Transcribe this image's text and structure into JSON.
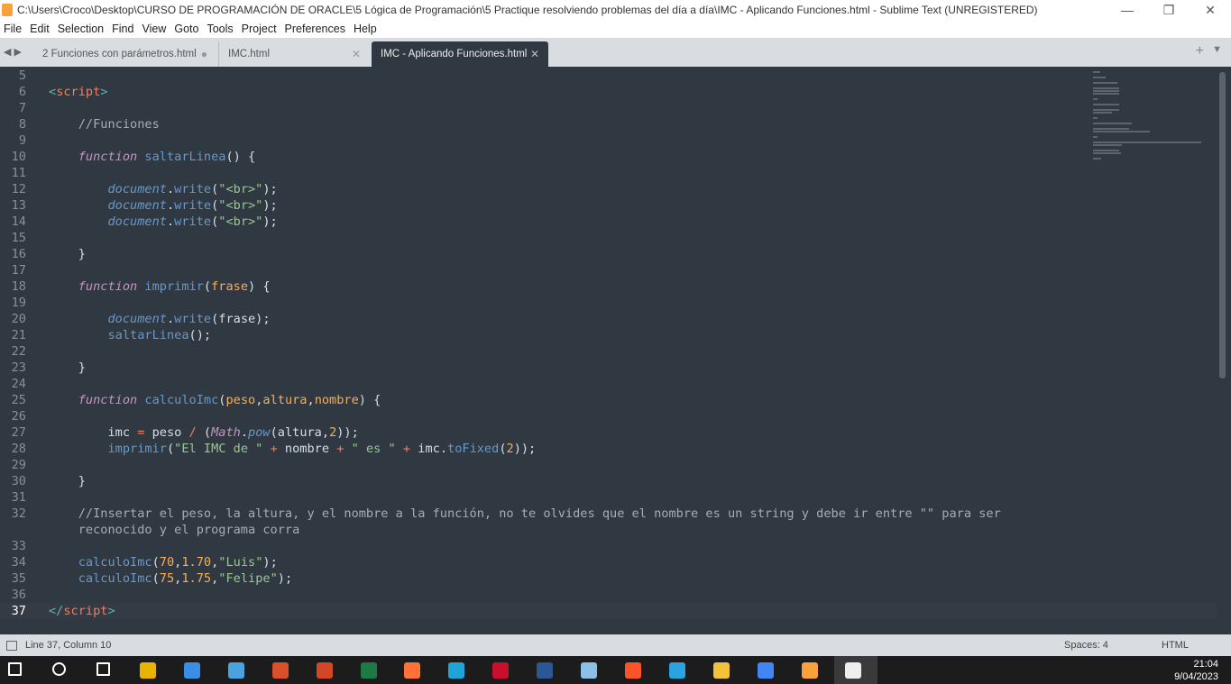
{
  "window": {
    "title": "C:\\Users\\Croco\\Desktop\\CURSO DE PROGRAMACIÓN DE ORACLE\\5 Lógica de Programación\\5 Practique resolviendo problemas del día a día\\IMC - Aplicando Funciones.html - Sublime Text (UNREGISTERED)",
    "minimize": "—",
    "maximize": "❐",
    "close": "✕"
  },
  "menu": [
    "File",
    "Edit",
    "Selection",
    "Find",
    "View",
    "Goto",
    "Tools",
    "Project",
    "Preferences",
    "Help"
  ],
  "tabs": [
    {
      "label": "2 Funciones con parámetros.html",
      "mark": "●"
    },
    {
      "label": "IMC.html",
      "mark": "✕"
    },
    {
      "label": "IMC - Aplicando Funciones.html",
      "mark": "✕",
      "active": true
    }
  ],
  "tabbar": {
    "nav": "◀ ▶",
    "plus": "+",
    "menu": "▼"
  },
  "colors": {
    "background": "#303841",
    "keyword": "#c594c5",
    "function": "#6699cc",
    "string": "#99c794",
    "operator": "#f97b58",
    "number": "#f9ae58"
  },
  "code": [
    {
      "n": "5",
      "t": []
    },
    {
      "n": "6",
      "t": [
        [
          "pu",
          "<"
        ],
        [
          "tg",
          "script"
        ],
        [
          "pu",
          ">"
        ]
      ]
    },
    {
      "n": "7",
      "t": []
    },
    {
      "n": "8",
      "t": [
        [
          "",
          "    "
        ],
        [
          "cm",
          "//Funciones"
        ]
      ]
    },
    {
      "n": "9",
      "t": []
    },
    {
      "n": "10",
      "t": [
        [
          "",
          "    "
        ],
        [
          "kw",
          "function"
        ],
        [
          "",
          " "
        ],
        [
          "fn",
          "saltarLinea"
        ],
        [
          "",
          "() {"
        ]
      ]
    },
    {
      "n": "11",
      "t": []
    },
    {
      "n": "12",
      "t": [
        [
          "",
          "        "
        ],
        [
          "fni",
          "document"
        ],
        [
          "",
          ".",
          ""
        ],
        [
          "fn",
          "write"
        ],
        [
          "",
          "("
        ],
        [
          "st",
          "\"<br>\""
        ],
        [
          "",
          ");"
        ]
      ]
    },
    {
      "n": "13",
      "t": [
        [
          "",
          "        "
        ],
        [
          "fni",
          "document"
        ],
        [
          "",
          "."
        ],
        [
          "fn",
          "write"
        ],
        [
          "",
          "("
        ],
        [
          "st",
          "\"<br>\""
        ],
        [
          "",
          ");"
        ]
      ]
    },
    {
      "n": "14",
      "t": [
        [
          "",
          "        "
        ],
        [
          "fni",
          "document"
        ],
        [
          "",
          "."
        ],
        [
          "fn",
          "write"
        ],
        [
          "",
          "("
        ],
        [
          "st",
          "\"<br>\""
        ],
        [
          "",
          ");"
        ]
      ]
    },
    {
      "n": "15",
      "t": []
    },
    {
      "n": "16",
      "t": [
        [
          "",
          "    }"
        ]
      ]
    },
    {
      "n": "17",
      "t": []
    },
    {
      "n": "18",
      "t": [
        [
          "",
          "    "
        ],
        [
          "kw",
          "function"
        ],
        [
          "",
          " "
        ],
        [
          "fn",
          "imprimir"
        ],
        [
          "",
          "("
        ],
        [
          "pm",
          "frase"
        ],
        [
          "",
          ") {"
        ]
      ]
    },
    {
      "n": "19",
      "t": []
    },
    {
      "n": "20",
      "t": [
        [
          "",
          "        "
        ],
        [
          "fni",
          "document"
        ],
        [
          "",
          "."
        ],
        [
          "fn",
          "write"
        ],
        [
          "",
          "(frase);"
        ]
      ]
    },
    {
      "n": "21",
      "t": [
        [
          "",
          "        "
        ],
        [
          "fn",
          "saltarLinea"
        ],
        [
          "",
          "();"
        ]
      ]
    },
    {
      "n": "22",
      "t": []
    },
    {
      "n": "23",
      "t": [
        [
          "",
          "    }"
        ]
      ]
    },
    {
      "n": "24",
      "t": []
    },
    {
      "n": "25",
      "t": [
        [
          "",
          "    "
        ],
        [
          "kw",
          "function"
        ],
        [
          "",
          " "
        ],
        [
          "fn",
          "calculoImc"
        ],
        [
          "",
          "("
        ],
        [
          "pm",
          "peso"
        ],
        [
          "",
          ","
        ],
        [
          "pm",
          "altura"
        ],
        [
          "",
          ","
        ],
        [
          "pm",
          "nombre"
        ],
        [
          "",
          ") {"
        ]
      ]
    },
    {
      "n": "26",
      "t": []
    },
    {
      "n": "27",
      "t": [
        [
          "",
          "        imc "
        ],
        [
          "op",
          "="
        ],
        [
          "",
          " peso "
        ],
        [
          "op",
          "/"
        ],
        [
          "",
          " ("
        ],
        [
          "mt",
          "Math"
        ],
        [
          "",
          "."
        ],
        [
          "fni",
          "pow"
        ],
        [
          "",
          "(altura,"
        ],
        [
          "nu",
          "2"
        ],
        [
          "",
          "));"
        ]
      ]
    },
    {
      "n": "28",
      "t": [
        [
          "",
          "        "
        ],
        [
          "fn",
          "imprimir"
        ],
        [
          "",
          "("
        ],
        [
          "st",
          "\"El IMC de \""
        ],
        [
          "",
          " "
        ],
        [
          "op",
          "+"
        ],
        [
          "",
          " nombre "
        ],
        [
          "op",
          "+"
        ],
        [
          "",
          " "
        ],
        [
          "st",
          "\" es \""
        ],
        [
          "",
          " "
        ],
        [
          "op",
          "+"
        ],
        [
          "",
          " imc."
        ],
        [
          "fn",
          "toFixed"
        ],
        [
          "",
          "("
        ],
        [
          "nu",
          "2"
        ],
        [
          "",
          "));"
        ]
      ]
    },
    {
      "n": "29",
      "t": []
    },
    {
      "n": "30",
      "t": [
        [
          "",
          "    }"
        ]
      ]
    },
    {
      "n": "31",
      "t": []
    },
    {
      "n": "32",
      "t": [
        [
          "",
          "    "
        ],
        [
          "cm",
          "//Insertar el peso, la altura, y el nombre a la función, no te olvides que el nombre es un string y debe ir entre \"\" para ser"
        ]
      ]
    },
    {
      "n": "",
      "t": [
        [
          "",
          "    "
        ],
        [
          "cm",
          "reconocido y el programa corra"
        ]
      ]
    },
    {
      "n": "33",
      "t": []
    },
    {
      "n": "34",
      "t": [
        [
          "",
          "    "
        ],
        [
          "fn",
          "calculoImc"
        ],
        [
          "",
          "("
        ],
        [
          "nu",
          "70"
        ],
        [
          "",
          ","
        ],
        [
          "nu",
          "1.70"
        ],
        [
          "",
          ","
        ],
        [
          "st",
          "\"Luis\""
        ],
        [
          "",
          ");"
        ]
      ]
    },
    {
      "n": "35",
      "t": [
        [
          "",
          "    "
        ],
        [
          "fn",
          "calculoImc"
        ],
        [
          "",
          "("
        ],
        [
          "nu",
          "75"
        ],
        [
          "",
          ","
        ],
        [
          "nu",
          "1.75"
        ],
        [
          "",
          ","
        ],
        [
          "st",
          "\"Felipe\""
        ],
        [
          "",
          ");"
        ]
      ]
    },
    {
      "n": "36",
      "t": []
    },
    {
      "n": "37",
      "t": [
        [
          "pu",
          "</"
        ],
        [
          "tg",
          "script"
        ],
        [
          "pu",
          ">"
        ]
      ],
      "current": true
    }
  ],
  "status": {
    "position": "Line 37, Column 10",
    "spaces": "Spaces: 4",
    "syntax": "HTML"
  },
  "taskbar": {
    "icons": [
      "windows-start",
      "search",
      "task-view",
      "app",
      "control-panel",
      "remote",
      "ccleaner",
      "powerpoint",
      "excel",
      "firefox",
      "edge",
      "app-red",
      "word",
      "paint",
      "brave",
      "telegram",
      "file-explorer",
      "chrome",
      "sublime-text",
      "app-active"
    ],
    "time": "21:04",
    "date": "9/04/2023"
  }
}
